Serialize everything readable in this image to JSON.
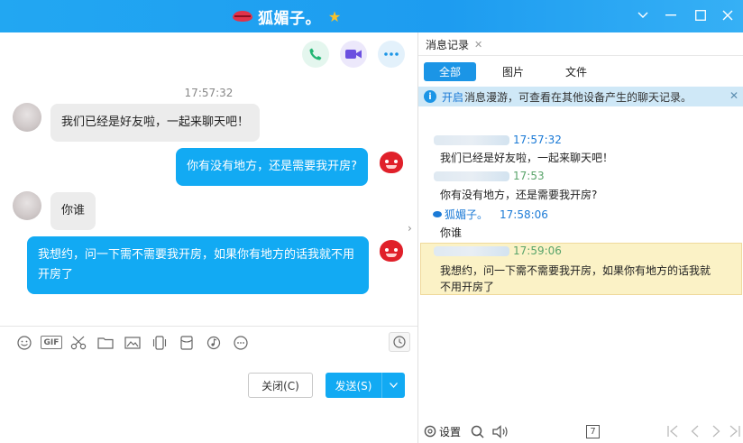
{
  "window": {
    "title": "狐媚子。",
    "controls": [
      "chevron-down",
      "minimize",
      "maximize",
      "close"
    ]
  },
  "chat": {
    "timestamp": "17:57:32",
    "messages": [
      {
        "side": "left",
        "text": "我们已经是好友啦，一起来聊天吧！"
      },
      {
        "side": "right",
        "text": "你有没有地方，还是需要我开房?"
      },
      {
        "side": "left",
        "text": "你谁"
      },
      {
        "side": "right",
        "text_line1": "我想约，问一下需不需要我开房，如果你有地方的话我就不用",
        "text_line2": "开房了"
      }
    ],
    "buttons": {
      "close": "关闭(C)",
      "send": "发送(S)"
    }
  },
  "history": {
    "tab_label": "消息记录",
    "filters": [
      "全部",
      "图片",
      "文件"
    ],
    "notice": {
      "link": "开启",
      "text": "消息漫游，可查看在其他设备产生的聊天记录。"
    },
    "entries": [
      {
        "time": "17:57:32",
        "text": "我们已经是好友啦，一起来聊天吧！"
      },
      {
        "time": "17:53",
        "text": "你有没有地方，还是需要我开房?"
      },
      {
        "sender": "狐媚子。",
        "time": "17:58:06",
        "text": "你谁"
      },
      {
        "time": "17:59:06",
        "text_line1": "我想约，问一下需不需要我开房，如果你有地方的话我就",
        "text_line2": "不用开房了"
      }
    ],
    "footer": {
      "settings": "设置",
      "page": "7"
    }
  },
  "colors": {
    "accent": "#12aaf3",
    "title_bar": "#1d9cf0",
    "highlight": "#fbf2c6"
  }
}
